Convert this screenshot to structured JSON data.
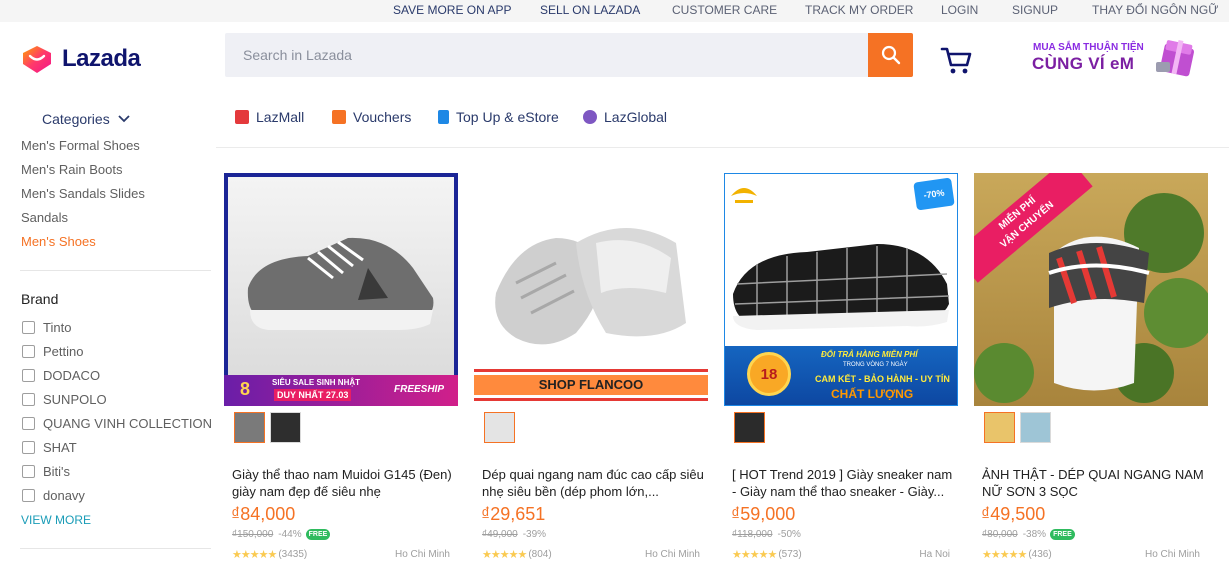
{
  "topbar": {
    "links": [
      "SAVE MORE ON APP",
      "SELL ON LAZADA",
      "CUSTOMER CARE",
      "TRACK MY ORDER",
      "LOGIN",
      "SIGNUP",
      "THAY ĐỔI NGÔN NGỮ"
    ]
  },
  "header": {
    "logo_text": "Lazada",
    "search_placeholder": "Search in Lazada",
    "promo_line1": "MUA SẮM THUẬN TIỆN",
    "promo_line2": "CÙNG VÍ eM"
  },
  "sidebar": {
    "categories_label": "Categories",
    "categories": [
      {
        "label": "Men's Formal Shoes",
        "active": false
      },
      {
        "label": "Men's Rain Boots",
        "active": false
      },
      {
        "label": "Men's Sandals Slides",
        "active": false
      },
      {
        "label": "Sandals",
        "active": false
      },
      {
        "label": "Men's Shoes",
        "active": true
      }
    ],
    "brand_title": "Brand",
    "brands": [
      "Tinto",
      "Pettino",
      "DODACO",
      "SUNPOLO",
      "QUANG VINH COLLECTION",
      "SHAT",
      "Biti's",
      "donavy"
    ],
    "view_more": "VIEW MORE"
  },
  "nav": {
    "tabs": [
      "LazMall",
      "Vouchers",
      "Top Up & eStore",
      "LazGlobal"
    ]
  },
  "products": [
    {
      "title": "Giày thể thao nam Muidoi G145 (Đen) giày nam đẹp đế siêu nhẹ",
      "price": "₫84,000",
      "original_price": "₫150,000",
      "discount": "-44%",
      "free_shipping": "FREE",
      "reviews": "(3435)",
      "location": "Ho Chi Minh",
      "banner_text": "SIÊU SALE SINH NHẬT",
      "banner_date": "DUY NHẤT 27.03",
      "banner_freeship": "FREESHIP",
      "banner_number": "8"
    },
    {
      "title": "Dép quai ngang nam đúc cao cấp siêu nhẹ siêu bền (dép phom lớn,...",
      "price": "₫29,651",
      "original_price": "₫49,000",
      "discount": "-39%",
      "reviews": "(804)",
      "location": "Ho Chi Minh",
      "shop_banner": "SHOP FLANCOO"
    },
    {
      "title": "[ HOT Trend 2019 ] Giày sneaker nam - Giày nam thể thao sneaker - Giày...",
      "price": "₫59,000",
      "original_price": "₫118,000",
      "discount": "-50%",
      "reviews": "(573)",
      "location": "Ha Noi",
      "banner_top": "ĐỔI TRẢ HÀNG MIỄN PHÍ",
      "banner_days": "TRONG VÒNG 7 NGÀY",
      "banner_commit": "CAM KẾT - BẢO HÀNH - UY TÍN",
      "banner_quality": "CHẤT LƯỢNG",
      "badge_months": "18",
      "badge_off": "-70%"
    },
    {
      "title": "ẢNH THẬT - DÉP QUAI NGANG NAM NỮ SƠN 3 SỌC",
      "price": "₫49,500",
      "original_price": "₫80,000",
      "discount": "-38%",
      "free_shipping": "FREE",
      "reviews": "(436)",
      "location": "Ho Chi Minh",
      "ribbon_line1": "MIỄN PHÍ",
      "ribbon_line2": "VẬN CHUYỂN"
    }
  ],
  "colors": {
    "accent": "#f57224",
    "brand_navy": "#0f146d",
    "link_blue": "#1a9cb7",
    "star": "#faca51",
    "free_green": "#2fbb5e"
  }
}
